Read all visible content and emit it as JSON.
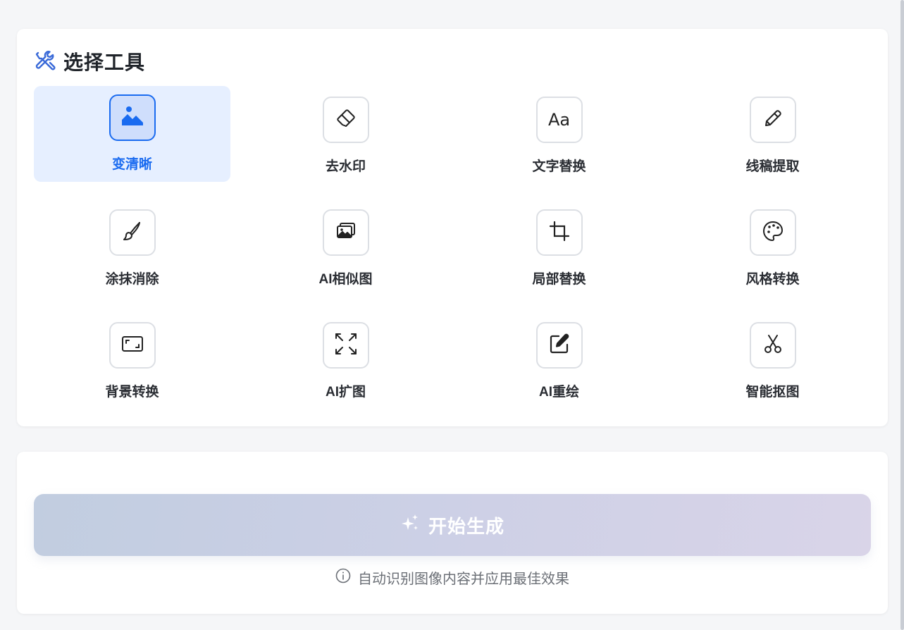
{
  "tools_section": {
    "title": "选择工具",
    "title_icon": "tools-icon",
    "tools": [
      {
        "label": "变清晰",
        "icon": "image-icon",
        "active": true
      },
      {
        "label": "去水印",
        "icon": "eraser-icon",
        "active": false
      },
      {
        "label": "文字替换",
        "icon": "text-aa-icon",
        "icon_text": "Aa",
        "active": false
      },
      {
        "label": "线稿提取",
        "icon": "pencil-icon",
        "active": false
      },
      {
        "label": "涂抹消除",
        "icon": "brush-icon",
        "active": false
      },
      {
        "label": "AI相似图",
        "icon": "images-icon",
        "active": false
      },
      {
        "label": "局部替换",
        "icon": "crop-icon",
        "active": false
      },
      {
        "label": "风格转换",
        "icon": "palette-icon",
        "active": false
      },
      {
        "label": "背景转换",
        "icon": "frame-icon",
        "active": false
      },
      {
        "label": "AI扩图",
        "icon": "expand-icon",
        "active": false
      },
      {
        "label": "AI重绘",
        "icon": "edit-icon",
        "active": false
      },
      {
        "label": "智能抠图",
        "icon": "scissors-icon",
        "active": false
      }
    ]
  },
  "action": {
    "generate_label": "开始生成",
    "generate_icon": "sparkles-icon",
    "hint_text": "自动识别图像内容并应用最佳效果",
    "hint_icon": "info-icon"
  },
  "colors": {
    "accent": "#1a6bf0",
    "active_bg": "#e6efff",
    "button_gradient_start": "#c1cde0",
    "button_gradient_end": "#d9d4e8"
  }
}
